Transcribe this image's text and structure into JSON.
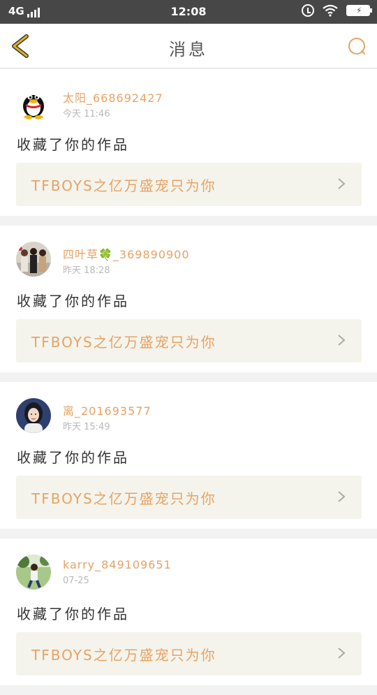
{
  "status_bar": {
    "network": "4G",
    "time": "12:08"
  },
  "header": {
    "title": "消息"
  },
  "messages": [
    {
      "name": "太阳_668692427",
      "time": "今天 11:46",
      "action": "收藏了你的作品",
      "work_title": "TFBOYS之亿万盛宠只为你",
      "avatar": "qq-penguin"
    },
    {
      "name": "四叶草🍀_369890900",
      "time": "昨天 18:28",
      "action": "收藏了你的作品",
      "work_title": "TFBOYS之亿万盛宠只为你",
      "avatar": "group-photo"
    },
    {
      "name": "离_201693577",
      "time": "昨天 15:49",
      "action": "收藏了你的作品",
      "work_title": "TFBOYS之亿万盛宠只为你",
      "avatar": "portrait"
    },
    {
      "name": "karry_849109651",
      "time": "07-25",
      "action": "收藏了你的作品",
      "work_title": "TFBOYS之亿万盛宠只为你",
      "avatar": "outdoor-photo"
    }
  ],
  "colors": {
    "accent": "#e8a264",
    "nav_back": "#e0b21e",
    "status_bar": "#474747"
  }
}
